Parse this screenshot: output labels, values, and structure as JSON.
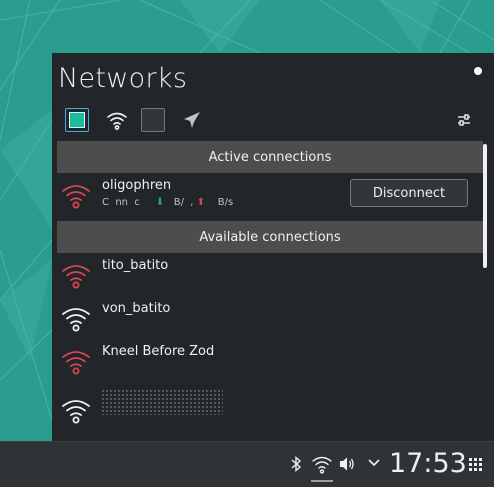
{
  "popup": {
    "title": "Networks",
    "toolbar": {
      "icons": [
        "ethernet-icon",
        "wifi-icon",
        "mobile-broadband-icon",
        "airplane-mode-icon",
        "configure-icon"
      ]
    },
    "sections": {
      "active": "Active connections",
      "available": "Available connections"
    },
    "active_connections": [
      {
        "name": "oligophren",
        "status_prefix": "C  nn  c",
        "down_arrow": "⬇",
        "down_value": "B/  ,",
        "up_arrow": "⬆",
        "up_value": "B/s",
        "signal": "weak",
        "action": "Disconnect"
      }
    ],
    "available_connections": [
      {
        "name": "tito_batito",
        "signal": "weak"
      },
      {
        "name": "von_batito",
        "signal": "strong"
      },
      {
        "name": "Kneel Before Zod",
        "signal": "weak"
      },
      {
        "name": "",
        "signal": "strong",
        "obscured": true
      }
    ]
  },
  "taskbar": {
    "clock": "17:53",
    "tray_icons": [
      "bluetooth-icon",
      "network-wifi-icon",
      "volume-icon",
      "expand-tray-icon",
      "app-grid-icon"
    ]
  },
  "colors": {
    "weak_signal": "#da4453",
    "strong_signal": "#eff0f1",
    "panel_bg": "#232629",
    "header_bg": "#4d4d4d",
    "wallpaper": "#2a9d8f"
  }
}
